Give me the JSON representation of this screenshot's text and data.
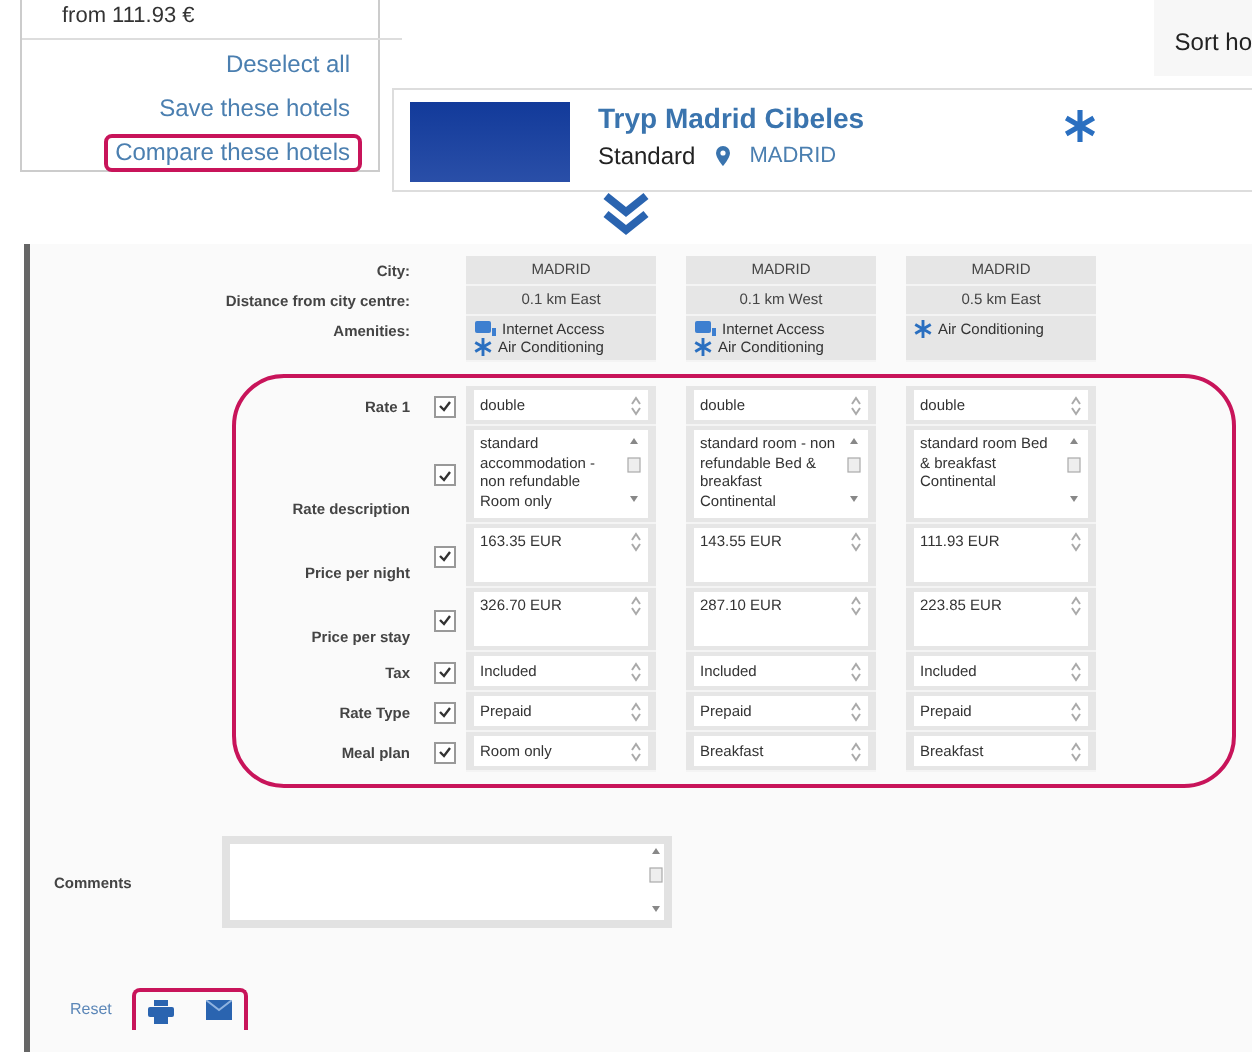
{
  "sidebar": {
    "price_from": "from 111.93 €",
    "links": [
      {
        "label": "Deselect all",
        "highlighted": false
      },
      {
        "label": "Save these hotels",
        "highlighted": false
      },
      {
        "label": "Compare these hotels",
        "highlighted": true
      }
    ]
  },
  "sort_label": "Sort ho",
  "hotel_card": {
    "name": "Tryp Madrid Cibeles",
    "category": "Standard",
    "city": "MADRID"
  },
  "compare": {
    "info_rows": [
      {
        "label": "City:",
        "values": [
          "MADRID",
          "MADRID",
          "MADRID"
        ]
      },
      {
        "label": "Distance from city centre:",
        "values": [
          "0.1 km East",
          "0.1 km West",
          "0.5 km East"
        ]
      }
    ],
    "amenities": {
      "label": "Amenities:",
      "values": [
        [
          {
            "kind": "internet",
            "label": "Internet Access"
          },
          {
            "kind": "ac",
            "label": "Air Conditioning"
          }
        ],
        [
          {
            "kind": "internet",
            "label": "Internet Access"
          },
          {
            "kind": "ac",
            "label": "Air Conditioning"
          }
        ],
        [
          {
            "kind": "ac",
            "label": "Air Conditioning"
          }
        ]
      ]
    },
    "rate_rows": [
      {
        "label": "Rate 1",
        "checked": true,
        "kind": "select",
        "values": [
          "double",
          "double",
          "double"
        ]
      },
      {
        "label": "Rate description",
        "checked": true,
        "kind": "textarea",
        "values": [
          "standard accommodation - non refundable Room only",
          "standard room - non refundable Bed & breakfast Continental",
          "standard room Bed & breakfast Continental"
        ]
      },
      {
        "label": "Price per night",
        "checked": true,
        "kind": "number",
        "values": [
          "163.35 EUR",
          "143.55 EUR",
          "111.93 EUR"
        ]
      },
      {
        "label": "Price per stay",
        "checked": true,
        "kind": "number",
        "values": [
          "326.70 EUR",
          "287.10 EUR",
          "223.85 EUR"
        ]
      },
      {
        "label": "Tax",
        "checked": true,
        "kind": "select",
        "values": [
          "Included",
          "Included",
          "Included"
        ]
      },
      {
        "label": "Rate Type",
        "checked": true,
        "kind": "select",
        "values": [
          "Prepaid",
          "Prepaid",
          "Prepaid"
        ]
      },
      {
        "label": "Meal plan",
        "checked": true,
        "kind": "select",
        "values": [
          "Room only",
          "Breakfast",
          "Breakfast"
        ]
      }
    ],
    "comments": {
      "label": "Comments"
    },
    "reset_label": "Reset"
  }
}
